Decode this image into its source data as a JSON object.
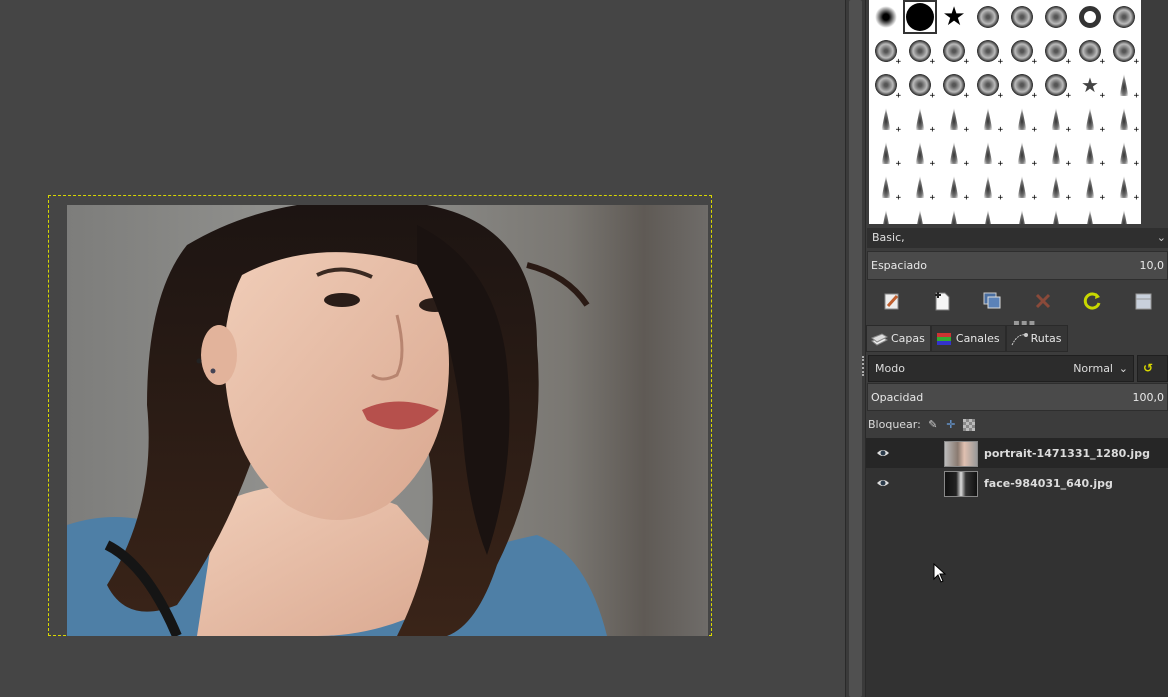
{
  "brushes": {
    "preset_label": "Basic,",
    "spacing_label": "Espaciado",
    "spacing_value": "10,0"
  },
  "tabs": [
    {
      "label": "Capas",
      "icon": "layers-icon"
    },
    {
      "label": "Canales",
      "icon": "channels-icon"
    },
    {
      "label": "Rutas",
      "icon": "paths-icon"
    }
  ],
  "layers_panel": {
    "mode_label": "Modo",
    "mode_value": "Normal",
    "opacity_label": "Opacidad",
    "opacity_value": "100,0",
    "lock_label": "Bloquear:",
    "layers": [
      {
        "name": "portrait-1471331_1280.jpg",
        "selected": true,
        "visible": true
      },
      {
        "name": "face-984031_640.jpg",
        "selected": false,
        "visible": true
      }
    ]
  },
  "colors": {
    "canvas_bg": "#454545",
    "dock_bg": "#3c3c3c",
    "selection_boundary": "#d8d800",
    "selected_row": "#262626"
  }
}
